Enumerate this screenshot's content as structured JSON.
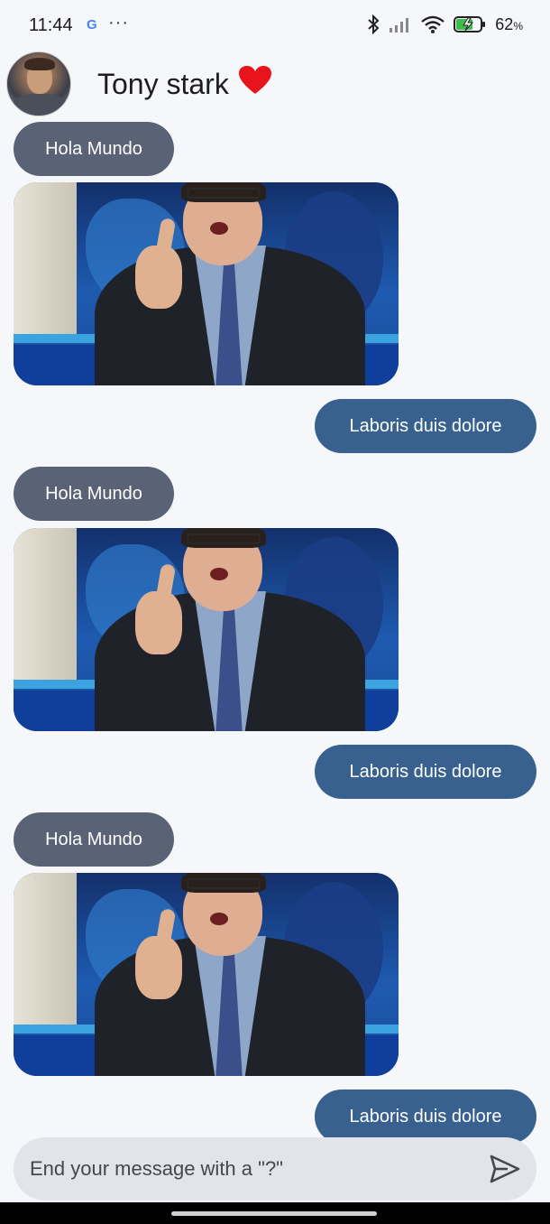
{
  "status_bar": {
    "time": "11:44",
    "google_glyph": "G",
    "more_glyph": "···",
    "battery_percent": "62",
    "battery_unit": "%",
    "icons": [
      "bluetooth-icon",
      "signal-icon",
      "wifi-icon",
      "battery-charging-icon"
    ]
  },
  "header": {
    "contact_name": "Tony stark",
    "heart_glyph": "❤️",
    "avatar_icon": "avatar"
  },
  "messages": [
    {
      "type": "received",
      "text": "Hola Mundo"
    },
    {
      "type": "gif"
    },
    {
      "type": "sent",
      "text": "Laboris duis dolore"
    },
    {
      "type": "received",
      "text": "Hola Mundo"
    },
    {
      "type": "gif"
    },
    {
      "type": "sent",
      "text": "Laboris duis dolore"
    },
    {
      "type": "received",
      "text": "Hola Mundo"
    },
    {
      "type": "gif"
    },
    {
      "type": "sent",
      "text": "Laboris duis dolore"
    }
  ],
  "composer": {
    "placeholder": "End your message with a \"?\"",
    "send_icon": "send-icon"
  },
  "colors": {
    "background": "#f6f7fb",
    "received_bubble": "#5a6275",
    "sent_bubble": "#38618f",
    "composer_bg": "#e3e4e9"
  }
}
